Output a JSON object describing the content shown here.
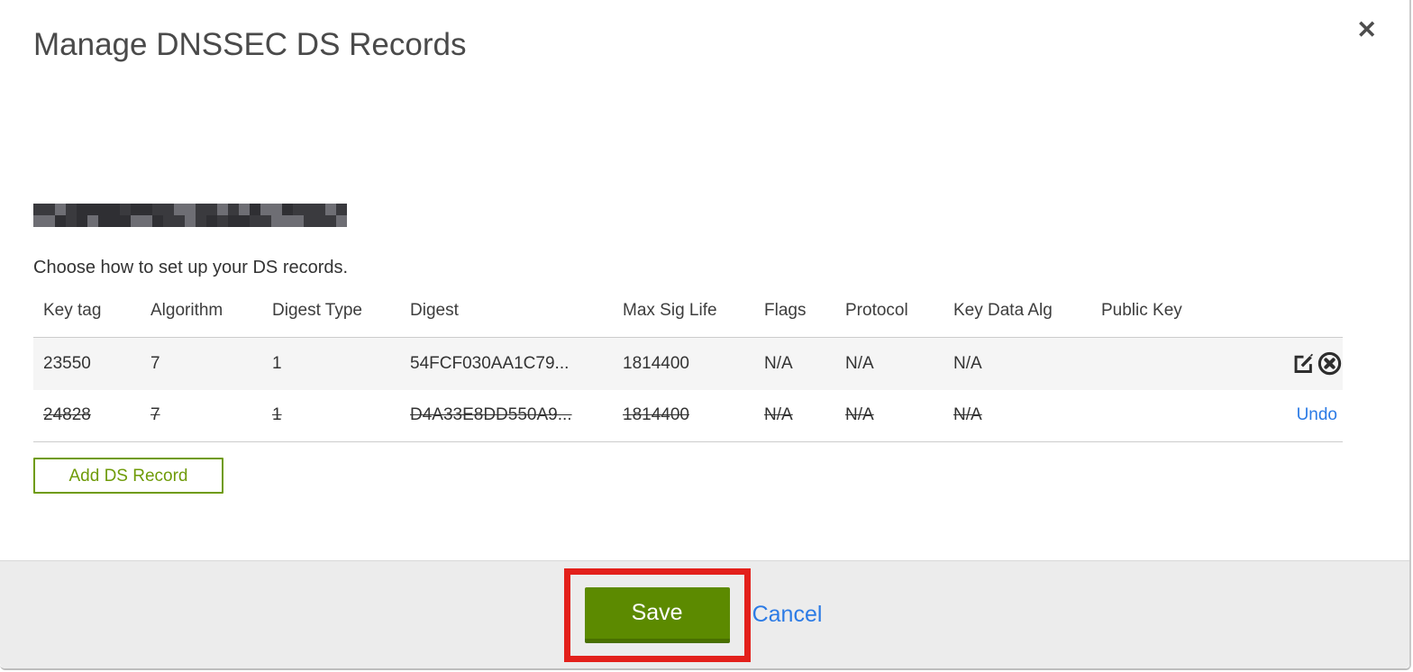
{
  "modal": {
    "title": "Manage DNSSEC DS Records",
    "close_glyph": "✕",
    "instruction": "Choose how to set up your DS records."
  },
  "table": {
    "columns": [
      "Key tag",
      "Algorithm",
      "Digest Type",
      "Digest",
      "Max Sig Life",
      "Flags",
      "Protocol",
      "Key Data Alg",
      "Public Key"
    ],
    "rows": [
      {
        "key_tag": "23550",
        "algorithm": "7",
        "digest_type": "1",
        "digest": "54FCF030AA1C79...",
        "max_sig_life": "1814400",
        "flags": "N/A",
        "protocol": "N/A",
        "key_data_alg": "N/A",
        "public_key": "",
        "state": "active"
      },
      {
        "key_tag": "24828",
        "algorithm": "7",
        "digest_type": "1",
        "digest": "D4A33E8DD550A9...",
        "max_sig_life": "1814400",
        "flags": "N/A",
        "protocol": "N/A",
        "key_data_alg": "N/A",
        "public_key": "",
        "state": "marked-for-deletion",
        "undo_label": "Undo"
      }
    ]
  },
  "actions": {
    "add_record_label": "Add DS Record",
    "save_label": "Save",
    "cancel_label": "Cancel"
  },
  "icons": {
    "close": "close-x",
    "edit": "edit-pencil-square",
    "delete": "delete-circle-x"
  },
  "colors": {
    "save_green": "#5c8a00",
    "save_green_dark": "#497000",
    "outline_green": "#6f9b08",
    "link_blue": "#2c7be5",
    "annotation_red": "#e3201b",
    "row_highlight_bg": "#f5f5f5",
    "footer_bg": "#ececec",
    "title_gray": "#4a4a4a"
  },
  "redaction": {
    "palette": [
      "#3a3a3e",
      "#5c5c62",
      "#8a8a90",
      "#b7b7bc",
      "#6e6e74",
      "#4a4a50",
      "#9c9ca2",
      "#cbcbcf",
      "#2f2f33",
      "#7d7d83",
      "#a9a9ad",
      "#55555b"
    ]
  }
}
